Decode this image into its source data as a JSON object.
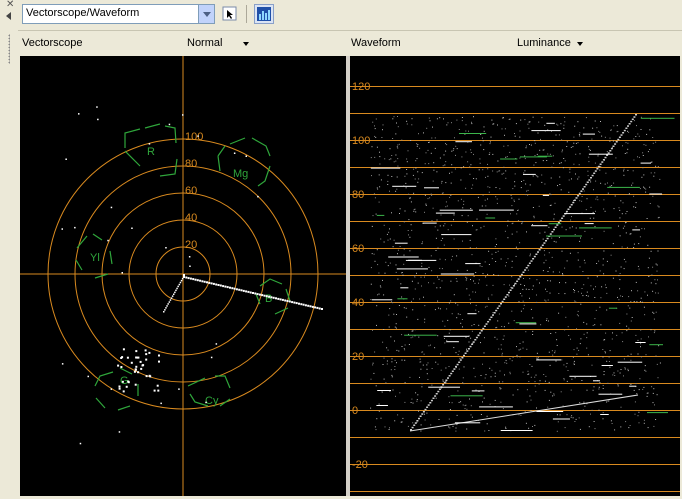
{
  "toolbar": {
    "view_select_value": "Vectorscope/Waveform",
    "buttons": [
      "cursor-icon",
      "histogram-icon"
    ]
  },
  "vectorscope": {
    "title": "Vectorscope",
    "mode": "Normal",
    "ring_labels": [
      "20",
      "40",
      "60",
      "80",
      "100"
    ],
    "targets": [
      "R",
      "Mg",
      "B",
      "Cy",
      "G",
      "Yl"
    ],
    "colors": {
      "graticule": "#d98a1f",
      "target": "#2fa63b",
      "trace": "#ffffff"
    }
  },
  "waveform": {
    "title": "Waveform",
    "mode": "Luminance",
    "scale_labels": [
      "120",
      "100",
      "80",
      "60",
      "40",
      "20",
      "0",
      "-20"
    ],
    "colors": {
      "grid": "#d98a1f",
      "trace": "#ffffff",
      "segment": "#3bb54a"
    }
  }
}
